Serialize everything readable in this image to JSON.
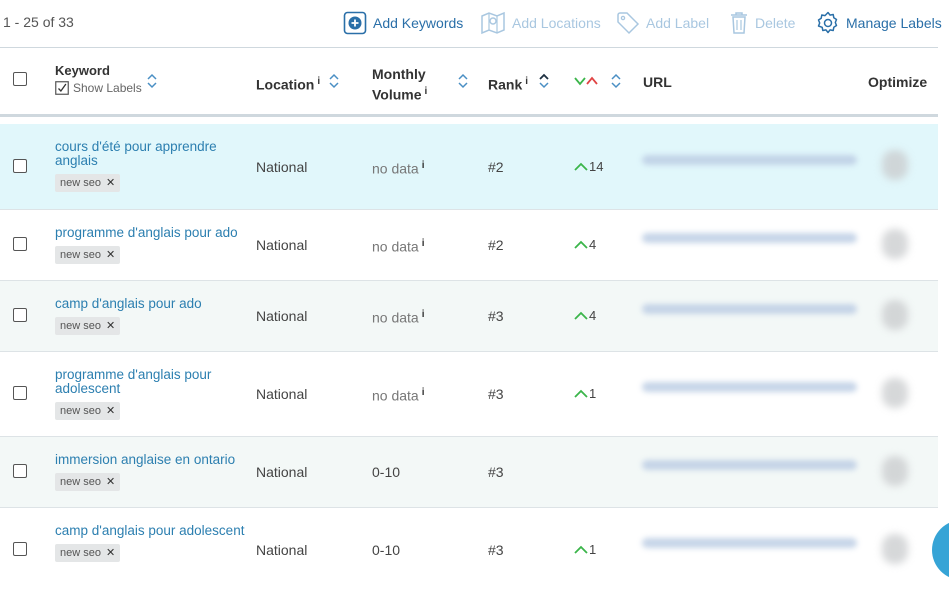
{
  "toolbar": {
    "pager": "1 - 25 of 33",
    "add_keywords": "Add Keywords",
    "add_locations": "Add Locations",
    "add_label": "Add Label",
    "delete": "Delete",
    "manage_labels": "Manage Labels"
  },
  "header": {
    "keyword": "Keyword",
    "show_labels": "Show Labels",
    "location": "Location",
    "monthly_line1": "Monthly",
    "monthly_line2": "Volume",
    "rank": "Rank",
    "url": "URL",
    "optimize": "Optimize",
    "info_glyph": "i"
  },
  "rows": [
    {
      "keyword": "cours d'été pour apprendre anglais",
      "label": "new seo",
      "location": "National",
      "volume": "no data",
      "rank": "#2",
      "change": "14"
    },
    {
      "keyword": "programme d'anglais pour ado",
      "label": "new seo",
      "location": "National",
      "volume": "no data",
      "rank": "#2",
      "change": "4"
    },
    {
      "keyword": "camp d'anglais pour ado",
      "label": "new seo",
      "location": "National",
      "volume": "no data",
      "rank": "#3",
      "change": "4"
    },
    {
      "keyword": "programme d'anglais pour adolescent",
      "label": "new seo",
      "location": "National",
      "volume": "no data",
      "rank": "#3",
      "change": "1"
    },
    {
      "keyword": "immersion anglaise en ontario",
      "label": "new seo",
      "location": "National",
      "volume": "0-10",
      "rank": "#3",
      "change": ""
    },
    {
      "keyword": "camp d'anglais pour adolescent",
      "label": "new seo",
      "location": "National",
      "volume": "0-10",
      "rank": "#3",
      "change": "1"
    }
  ],
  "colors": {
    "accent": "#2a6fa8",
    "disabled": "#a9c7e0",
    "up": "#3bb54a",
    "down": "#e04444"
  }
}
